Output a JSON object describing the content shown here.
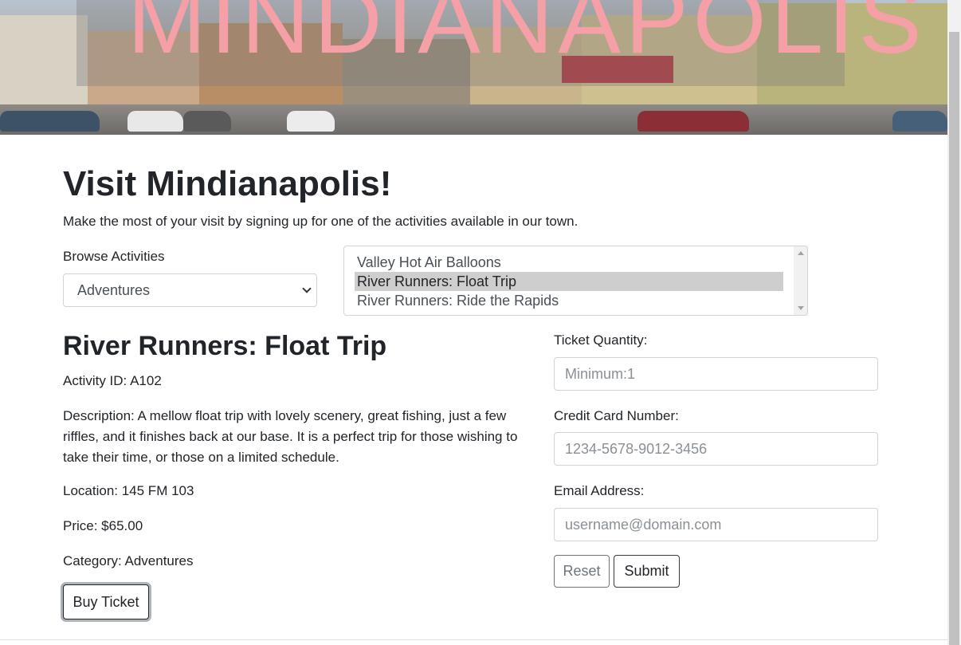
{
  "hero": {
    "banner_text": "MINDIANAPOLIS"
  },
  "page": {
    "title": "Visit Mindianapolis!",
    "lead": "Make the most of your visit by signing up for one of the activities available in our town."
  },
  "browse": {
    "label": "Browse Activities",
    "selected_category": "Adventures"
  },
  "activities": {
    "items": [
      {
        "label": "Valley Hot Air Balloons",
        "selected": false
      },
      {
        "label": "River Runners: Float Trip",
        "selected": true
      },
      {
        "label": "River Runners: Ride the Rapids",
        "selected": false
      }
    ]
  },
  "details": {
    "name": "River Runners: Float Trip",
    "activity_id": "Activity ID: A102",
    "description": "Description: A mellow float trip with lovely scenery, great fishing, just a few riffles, and it finishes back at our base. It is a perfect trip for those wishing to take their time, or those on a limited schedule.",
    "location": "Location: 145 FM 103",
    "price": "Price: $65.00",
    "category": "Category: Adventures",
    "buy_label": "Buy Ticket"
  },
  "form": {
    "quantity_label": "Ticket Quantity:",
    "quantity_placeholder": "Minimum:1",
    "card_label": "Credit Card Number:",
    "card_placeholder": "1234-5678-9012-3456",
    "email_label": "Email Address:",
    "email_placeholder": "username@domain.com",
    "reset_label": "Reset",
    "submit_label": "Submit"
  },
  "colors": {
    "banner_text": "#f4a0a6",
    "text": "#212529",
    "selected_option_bg": "#cecece"
  }
}
